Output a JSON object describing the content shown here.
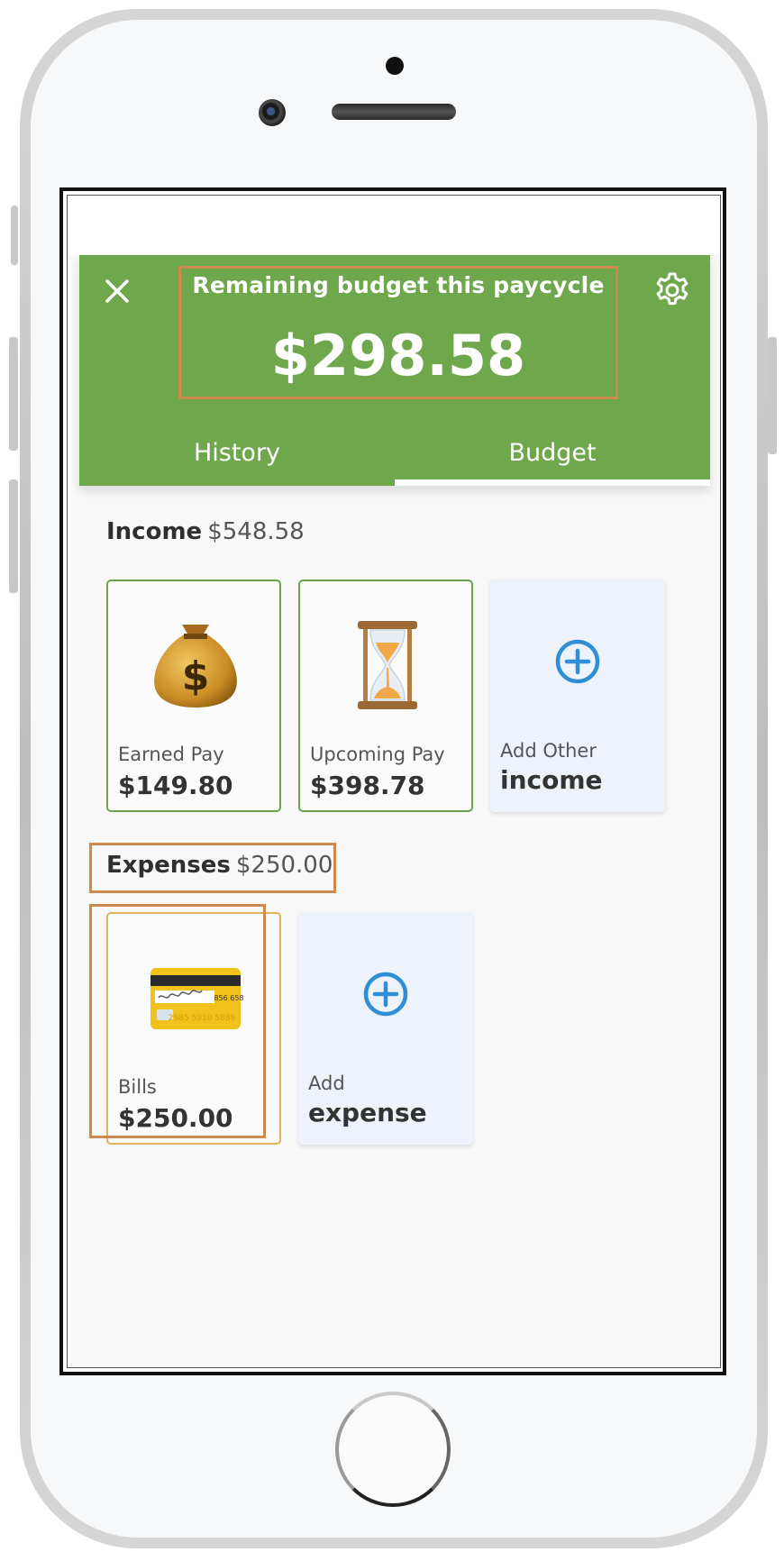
{
  "header": {
    "budget_title": "Remaining budget this paycycle",
    "budget_amount": "$298.58",
    "accent_color": "#6fa84c"
  },
  "tabs": [
    {
      "label": "History",
      "active": false
    },
    {
      "label": "Budget",
      "active": true
    }
  ],
  "income": {
    "title": "Income",
    "amount": "$548.58",
    "cards": [
      {
        "icon": "money-bag-icon",
        "label": "Earned Pay",
        "value": "$149.80"
      },
      {
        "icon": "hourglass-icon",
        "label": "Upcoming Pay",
        "value": "$398.78"
      },
      {
        "icon": "plus-circle-icon",
        "label": "Add Other",
        "value": "income"
      }
    ]
  },
  "expenses": {
    "title": "Expenses",
    "amount": "$250.00",
    "cards": [
      {
        "icon": "credit-card-icon",
        "label": "Bills",
        "value": "$250.00"
      },
      {
        "icon": "plus-circle-icon",
        "label": "Add",
        "value": "expense"
      }
    ]
  },
  "colors": {
    "highlight": "#cc8a4e",
    "card_border": "#6ba44a",
    "add_card_bg": "#eef3fb",
    "plus_blue": "#2f8fd6"
  }
}
